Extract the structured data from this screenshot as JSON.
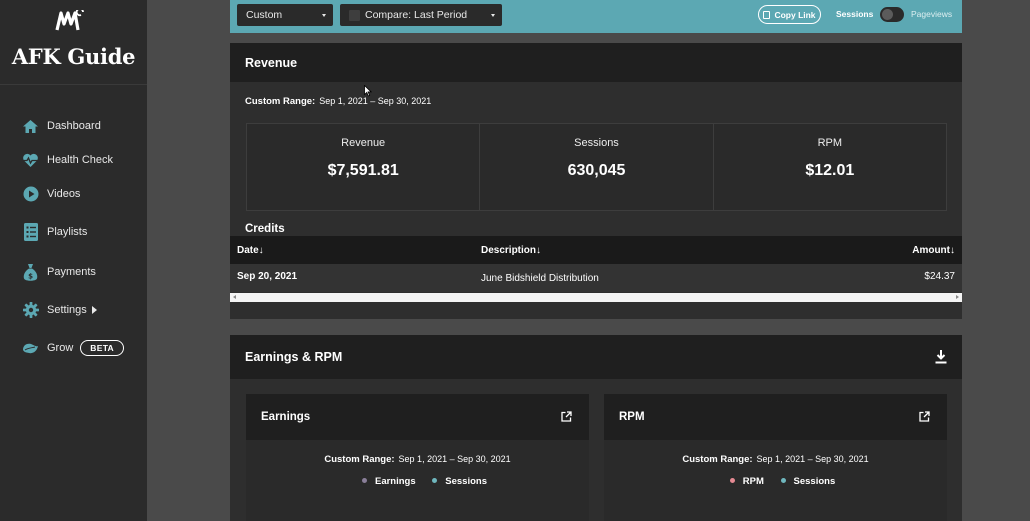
{
  "app": {
    "brand": "AFK Guide"
  },
  "sidebar": {
    "items": [
      {
        "label": "Dashboard",
        "icon": "home-icon"
      },
      {
        "label": "Health Check",
        "icon": "heartbeat-icon"
      },
      {
        "label": "Videos",
        "icon": "play-circle-icon"
      },
      {
        "label": "Playlists",
        "icon": "list-icon"
      },
      {
        "label": "Payments",
        "icon": "money-bag-icon"
      },
      {
        "label": "Settings",
        "icon": "gear-icon"
      },
      {
        "label": "Grow",
        "icon": "grow-icon",
        "badge": "BETA"
      }
    ]
  },
  "toolbar": {
    "range_select": "Custom",
    "compare_select": "Compare: Last Period",
    "copy_link": "Copy Link",
    "toggle_left": "Sessions",
    "toggle_right": "Pageviews"
  },
  "revenue": {
    "title": "Revenue",
    "range_label": "Custom Range:",
    "range_value": "Sep 1, 2021 – Sep 30, 2021",
    "stats": [
      {
        "label": "Revenue",
        "value": "$7,591.81"
      },
      {
        "label": "Sessions",
        "value": "630,045"
      },
      {
        "label": "RPM",
        "value": "$12.01"
      }
    ],
    "credits": {
      "title": "Credits",
      "columns": [
        "Date↓",
        "Description↓",
        "Amount↓"
      ],
      "rows": [
        {
          "date": "Sep 20, 2021",
          "description": "June Bidshield Distribution",
          "amount": "$24.37"
        }
      ]
    }
  },
  "earnings_rpm": {
    "title": "Earnings & RPM",
    "cards": [
      {
        "title": "Earnings",
        "range_label": "Custom Range:",
        "range_value": "Sep 1, 2021 – Sep 30, 2021",
        "legend": [
          {
            "label": "Earnings",
            "color": "#8a7f99"
          },
          {
            "label": "Sessions",
            "color": "#6fb7be"
          }
        ]
      },
      {
        "title": "RPM",
        "range_label": "Custom Range:",
        "range_value": "Sep 1, 2021 – Sep 30, 2021",
        "legend": [
          {
            "label": "RPM",
            "color": "#e58a93"
          },
          {
            "label": "Sessions",
            "color": "#6fb7be"
          }
        ]
      }
    ]
  },
  "colors": {
    "accent": "#5ca8b3",
    "sidebar": "#2b2b2b",
    "background": "#4a4a4a"
  }
}
